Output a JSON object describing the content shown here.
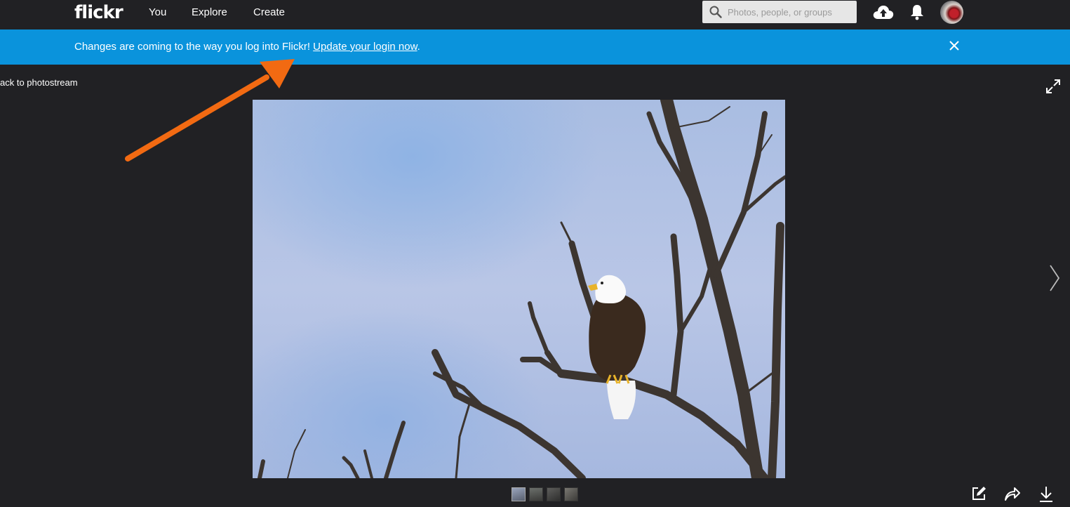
{
  "header": {
    "logo": "flickr",
    "nav": [
      "You",
      "Explore",
      "Create"
    ],
    "search_placeholder": "Photos, people, or groups",
    "icons": [
      "search-icon",
      "upload-cloud-icon",
      "bell-icon",
      "avatar"
    ]
  },
  "banner": {
    "message": "Changes are coming to the way you log into Flickr! ",
    "link_text": "Update your login now",
    "suffix": ".",
    "close_icon": "close-icon",
    "color": "#0a93dc"
  },
  "viewer": {
    "back_text": "ack to photostream",
    "icons": [
      "expand-icon",
      "chevron-right-icon",
      "edit-icon",
      "share-icon",
      "download-icon"
    ],
    "thumbnails_count": 4
  },
  "colors": {
    "background": "#212124",
    "annotation_arrow": "#f26a12"
  }
}
